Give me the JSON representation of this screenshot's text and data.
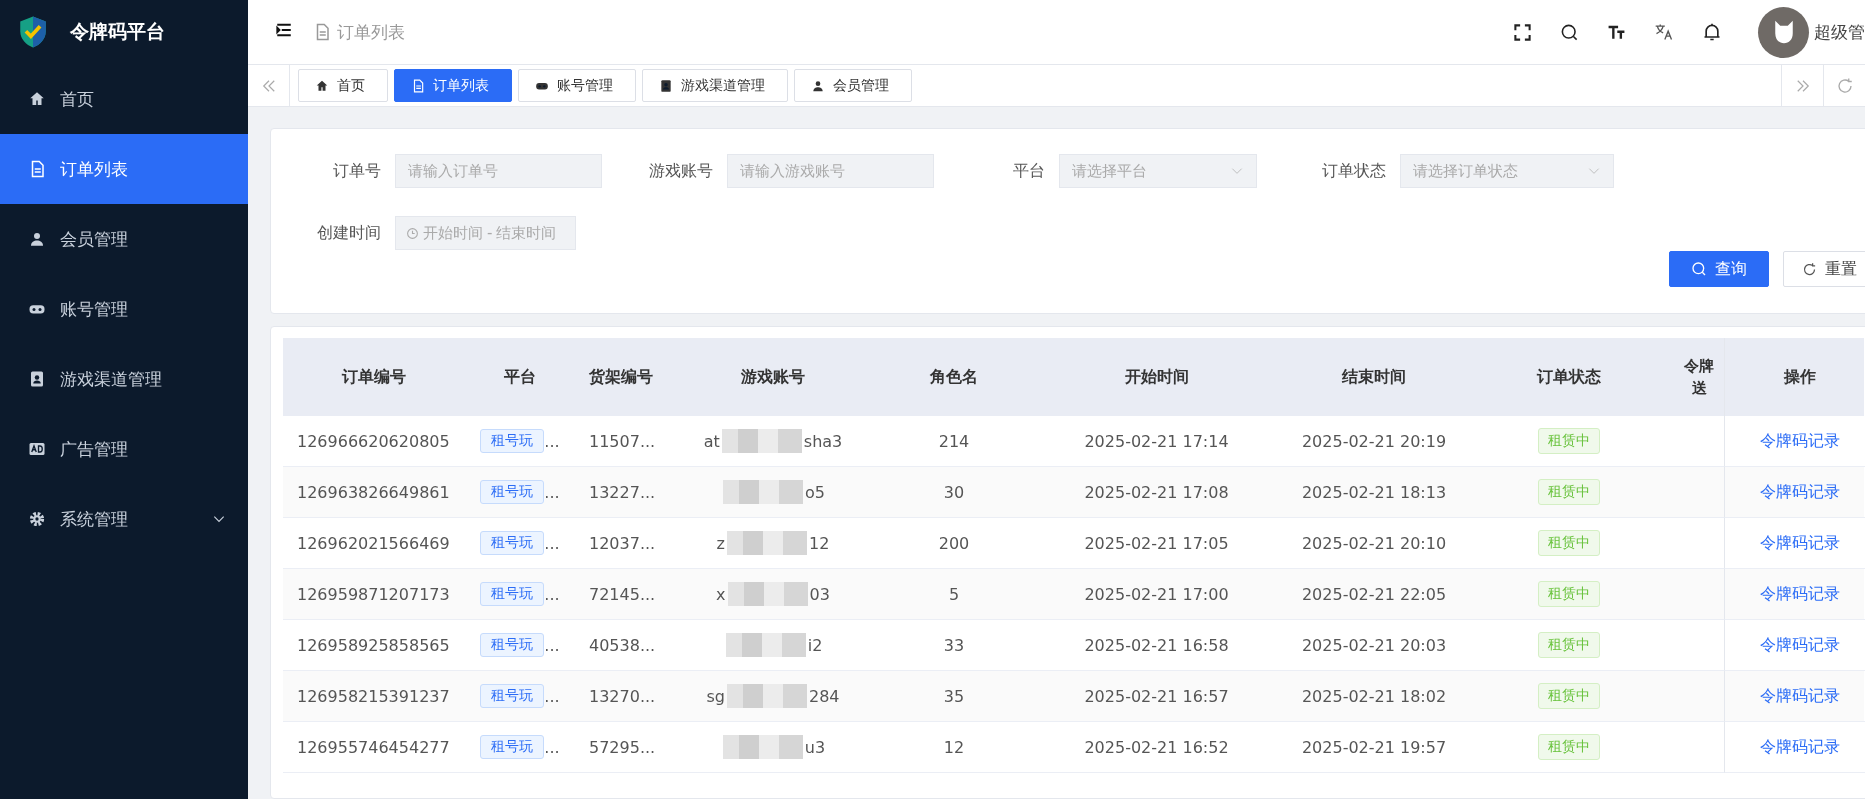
{
  "app": {
    "title": "令牌码平台"
  },
  "sidebar": {
    "items": [
      {
        "label": "首页",
        "selected": false,
        "has_submenu": false
      },
      {
        "label": "订单列表",
        "selected": true,
        "has_submenu": false
      },
      {
        "label": "会员管理",
        "selected": false,
        "has_submenu": false
      },
      {
        "label": "账号管理",
        "selected": false,
        "has_submenu": false
      },
      {
        "label": "游戏渠道管理",
        "selected": false,
        "has_submenu": false
      },
      {
        "label": "广告管理",
        "selected": false,
        "has_submenu": false
      },
      {
        "label": "系统管理",
        "selected": false,
        "has_submenu": true
      }
    ]
  },
  "header": {
    "breadcrumb": "订单列表",
    "user_name": "超级管"
  },
  "tabs": [
    {
      "label": "首页",
      "selected": false
    },
    {
      "label": "订单列表",
      "selected": true
    },
    {
      "label": "账号管理",
      "selected": false
    },
    {
      "label": "游戏渠道管理",
      "selected": false
    },
    {
      "label": "会员管理",
      "selected": false
    }
  ],
  "filters": {
    "order_no": {
      "label": "订单号",
      "placeholder": "请输入订单号"
    },
    "game_account": {
      "label": "游戏账号",
      "placeholder": "请输入游戏账号"
    },
    "platform": {
      "label": "平台",
      "placeholder": "请选择平台"
    },
    "order_status": {
      "label": "订单状态",
      "placeholder": "请选择订单状态"
    },
    "created_time": {
      "label": "创建时间",
      "start_placeholder": "开始时间",
      "separator": "-",
      "end_placeholder": "结束时间"
    },
    "buttons": {
      "query": "查询",
      "reset": "重置"
    }
  },
  "table": {
    "columns": [
      "订单编号",
      "平台",
      "货架编号",
      "游戏账号",
      "角色名",
      "开始时间",
      "结束时间",
      "订单状态",
      "令牌送",
      "操作"
    ],
    "rows": [
      {
        "order_no": "126966620620805",
        "platform": "租号玩",
        "platform_more": "...",
        "shelf_no": "11507...",
        "account_start": "at",
        "account_end": "sha3",
        "role": "214",
        "start": "2025-02-21 17:14",
        "end": "2025-02-21 20:19",
        "status": "租赁中",
        "action": "令牌码记录"
      },
      {
        "order_no": "126963826649861",
        "platform": "租号玩",
        "platform_more": "...",
        "shelf_no": "13227...",
        "account_end": "o5",
        "role": "30",
        "start": "2025-02-21 17:08",
        "end": "2025-02-21 18:13",
        "status": "租赁中",
        "action": "令牌码记录"
      },
      {
        "order_no": "126962021566469",
        "platform": "租号玩",
        "platform_more": "...",
        "shelf_no": "12037...",
        "account_start": "z",
        "account_end": "12",
        "role": "200",
        "start": "2025-02-21 17:05",
        "end": "2025-02-21 20:10",
        "status": "租赁中",
        "action": "令牌码记录"
      },
      {
        "order_no": "126959871207173",
        "platform": "租号玩",
        "platform_more": "...",
        "shelf_no": "72145...",
        "account_start": "x",
        "account_end": "03",
        "role": "5",
        "start": "2025-02-21 17:00",
        "end": "2025-02-21 22:05",
        "status": "租赁中",
        "action": "令牌码记录"
      },
      {
        "order_no": "126958925858565",
        "platform": "租号玩",
        "platform_more": "...",
        "shelf_no": "40538...",
        "account_end": "i2",
        "role": "33",
        "start": "2025-02-21 16:58",
        "end": "2025-02-21 20:03",
        "status": "租赁中",
        "action": "令牌码记录"
      },
      {
        "order_no": "126958215391237",
        "platform": "租号玩",
        "platform_more": "...",
        "shelf_no": "13270...",
        "account_start": "sg",
        "account_end": "284",
        "role": "35",
        "start": "2025-02-21 16:57",
        "end": "2025-02-21 18:02",
        "status": "租赁中",
        "action": "令牌码记录"
      },
      {
        "order_no": "126955746454277",
        "platform": "租号玩",
        "platform_more": "...",
        "shelf_no": "57295...",
        "account_end": "u3",
        "role": "12",
        "start": "2025-02-21 16:52",
        "end": "2025-02-21 19:57",
        "status": "租赁中",
        "action": "令牌码记录"
      }
    ]
  }
}
